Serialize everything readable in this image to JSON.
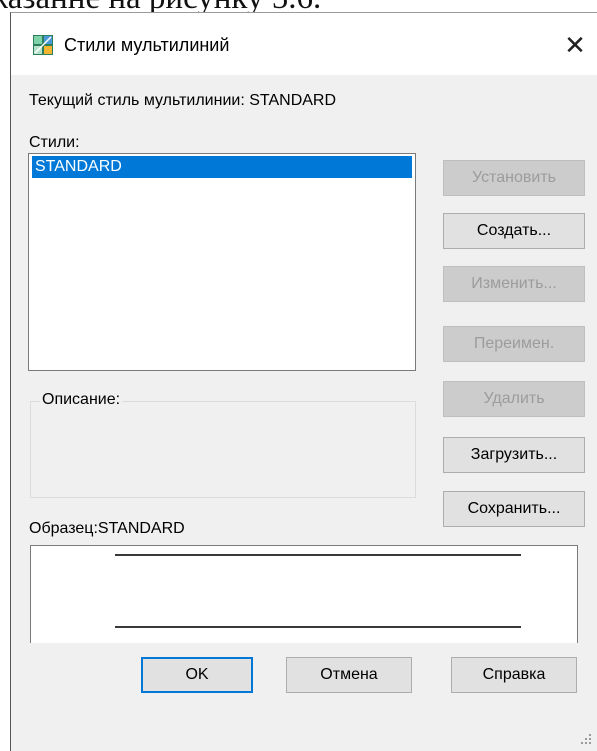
{
  "doc_text": "жазанне на рисунку 5.6.",
  "dialog": {
    "title": "Стили мультилиний",
    "close_glyph": "✕",
    "current_style_label": "Текущий стиль мультилинии: STANDARD",
    "styles_label": "Стили:",
    "styles": [
      "STANDARD"
    ],
    "description_label": "Описание:",
    "preview_label": "Образец:STANDARD",
    "buttons": {
      "set": "Установить",
      "create": "Создать...",
      "modify": "Изменить...",
      "rename": "Переимен.",
      "delete": "Удалить",
      "load": "Загрузить...",
      "save": "Сохранить...",
      "ok": "OK",
      "cancel": "Отмена",
      "help": "Справка"
    }
  },
  "icons": {
    "app": "multiline-style-icon",
    "close": "close-icon",
    "grip": "resize-grip-icon"
  },
  "colors": {
    "selection": "#0078d7",
    "dialog_bg": "#f0f0f0",
    "disabled_text": "#9c9c9c"
  }
}
